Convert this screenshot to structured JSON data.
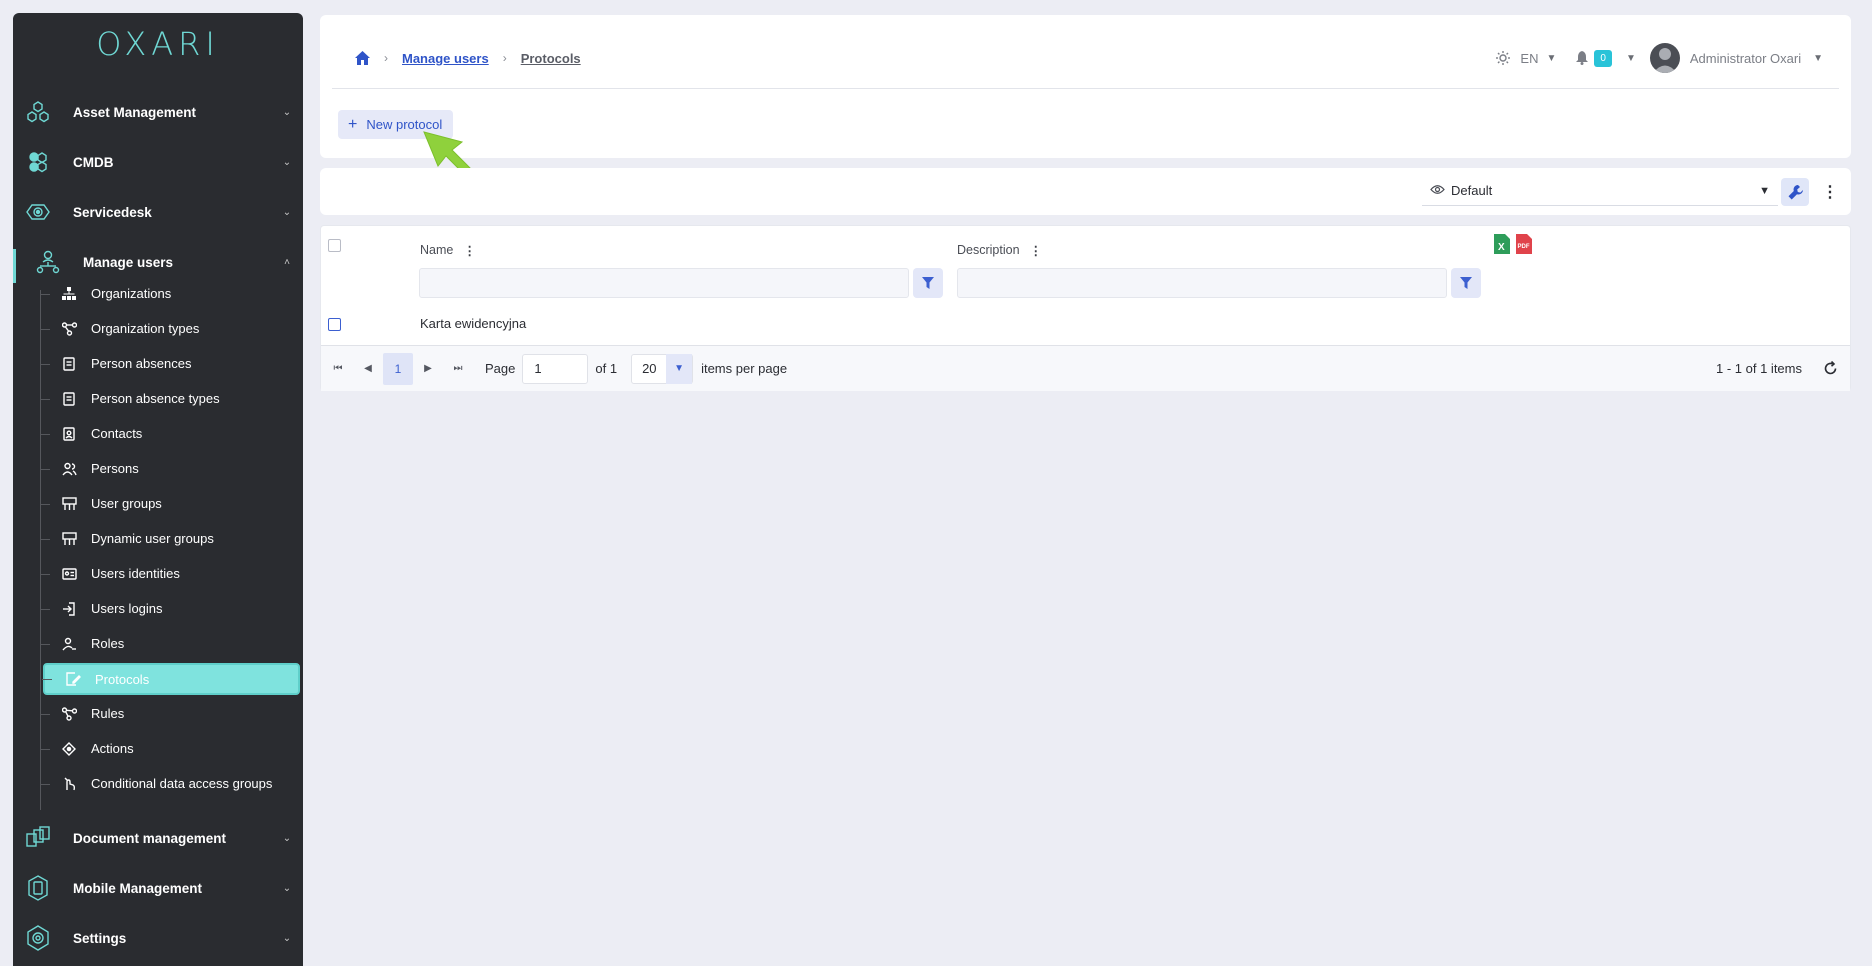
{
  "logo": "OXARI",
  "sidebar": {
    "sections": [
      {
        "label": "Asset Management",
        "icon": "hexagons-icon"
      },
      {
        "label": "CMDB",
        "icon": "cubes-icon"
      },
      {
        "label": "Servicedesk",
        "icon": "eye-gear-icon"
      },
      {
        "label": "Manage users",
        "icon": "users-tree-icon"
      },
      {
        "label": "Document management",
        "icon": "documents-icon"
      },
      {
        "label": "Mobile Management",
        "icon": "mobile-icon"
      },
      {
        "label": "Settings",
        "icon": "gear-icon"
      }
    ],
    "sub_items": [
      {
        "label": "Organizations",
        "icon": "org-tree-icon"
      },
      {
        "label": "Organization types",
        "icon": "nodes-icon"
      },
      {
        "label": "Person absences",
        "icon": "document-list-icon"
      },
      {
        "label": "Person absence types",
        "icon": "document-list-icon"
      },
      {
        "label": "Contacts",
        "icon": "contact-card-icon"
      },
      {
        "label": "Persons",
        "icon": "persons-icon"
      },
      {
        "label": "User groups",
        "icon": "group-board-icon"
      },
      {
        "label": "Dynamic user groups",
        "icon": "group-board-icon"
      },
      {
        "label": "Users identities",
        "icon": "id-card-icon"
      },
      {
        "label": "Users logins",
        "icon": "login-icon"
      },
      {
        "label": "Roles",
        "icon": "user-role-icon"
      },
      {
        "label": "Protocols",
        "icon": "edit-document-icon"
      },
      {
        "label": "Rules",
        "icon": "rules-icon"
      },
      {
        "label": "Actions",
        "icon": "target-icon"
      },
      {
        "label": "Conditional data access groups",
        "icon": "hand-lock-icon"
      }
    ],
    "selected": "Protocols"
  },
  "breadcrumb": {
    "items": [
      "Manage users",
      "Protocols"
    ]
  },
  "header": {
    "language": "EN",
    "notifications": "0",
    "user": "Administrator Oxari"
  },
  "toolbar": {
    "new_label": "New protocol",
    "view_label": "Default"
  },
  "grid": {
    "columns": [
      "Name",
      "Description"
    ],
    "rows": [
      {
        "name": "Karta ewidencyjna",
        "description": ""
      }
    ],
    "export_icons": [
      "excel-icon",
      "pdf-icon"
    ]
  },
  "pager": {
    "current_page": "1",
    "page_label": "Page",
    "page_input": "1",
    "of_label": "of 1",
    "page_size": "20",
    "per_page_label": "items per page",
    "info": "1 - 1 of 1 items"
  },
  "colors": {
    "accent": "#6fd8d4",
    "link": "#2f54c8",
    "sidebar_bg": "#2a2c30",
    "badge": "#29c3d8"
  }
}
